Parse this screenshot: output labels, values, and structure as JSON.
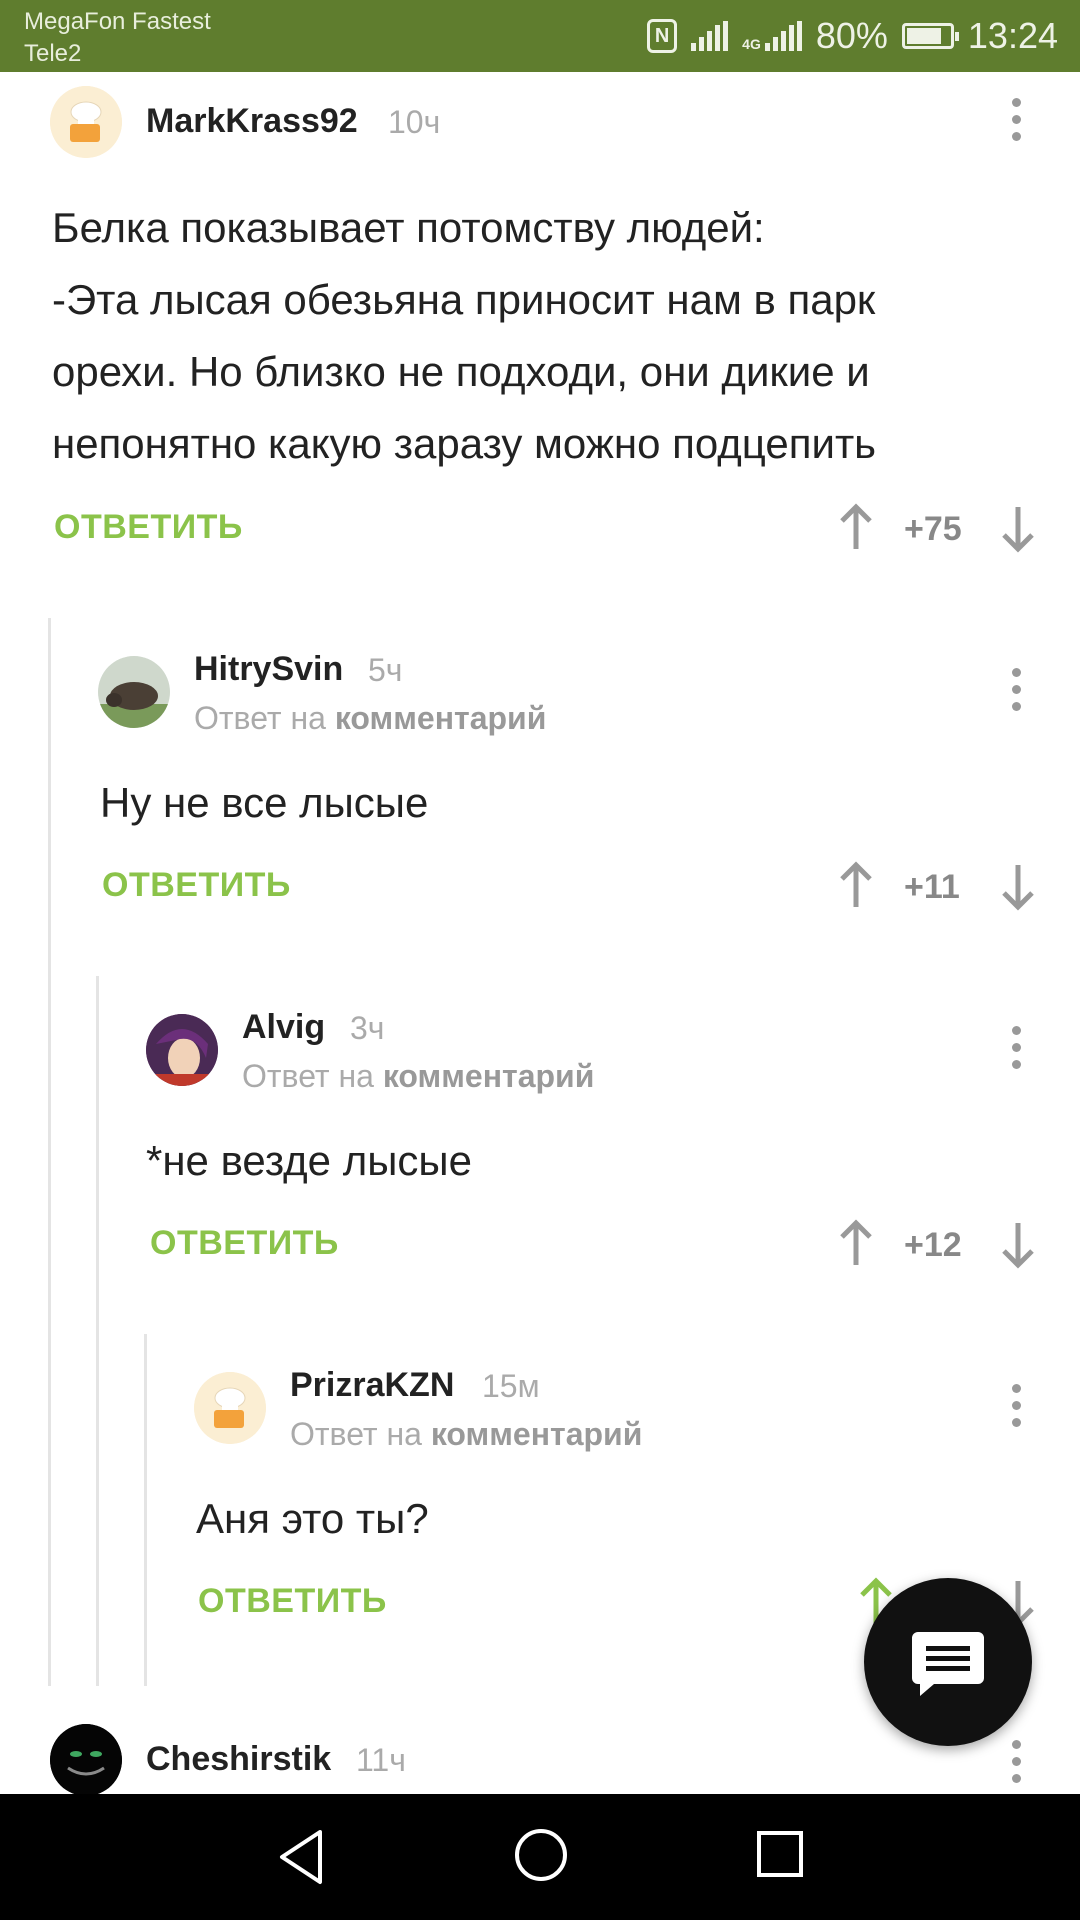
{
  "status_bar": {
    "carrier_primary": "MegaFon Fastest",
    "carrier_secondary": "Tele2",
    "network_type": "4G",
    "battery": "80%",
    "time": "13:24"
  },
  "comments": [
    {
      "username": "MarkKrass92",
      "time": "10ч",
      "reply_to_prefix": "",
      "reply_to_link": "",
      "text_lines": [
        "Белка показывает потомству людей:",
        "-Эта лысая обезьяна приносит нам в парк",
        "орехи. Но близко не подходи, они дикие и",
        "непонятно какую заразу можно подцепить"
      ],
      "reply_label": "ОТВЕТИТЬ",
      "score": "+75"
    },
    {
      "username": "HitrySvin",
      "time": "5ч",
      "reply_to_prefix": "Ответ на",
      "reply_to_link": "комментарий",
      "text_lines": [
        "Ну не все лысые"
      ],
      "reply_label": "ОТВЕТИТЬ",
      "score": "+11"
    },
    {
      "username": "Alvig",
      "time": "3ч",
      "reply_to_prefix": "Ответ на",
      "reply_to_link": "комментарий",
      "text_lines": [
        "*не везде лысые"
      ],
      "reply_label": "ОТВЕТИТЬ",
      "score": "+12"
    },
    {
      "username": "PrizraKZN",
      "time": "15м",
      "reply_to_prefix": "Ответ на",
      "reply_to_link": "комментарий",
      "text_lines": [
        "Аня это ты?"
      ],
      "reply_label": "ОТВЕТИТЬ",
      "score": ""
    },
    {
      "username": "Cheshirstik",
      "time": "11ч"
    }
  ],
  "colors": {
    "status_bar": "#5f7d2e",
    "reply_green": "#8bc34a",
    "upvote_active": "#8bc34a",
    "muted": "#aaaaaa",
    "fab": "#111111"
  },
  "icons": {
    "fab": "comment-icon",
    "nav_back": "back-triangle-icon",
    "nav_home": "home-circle-icon",
    "nav_recents": "recents-square-icon"
  }
}
